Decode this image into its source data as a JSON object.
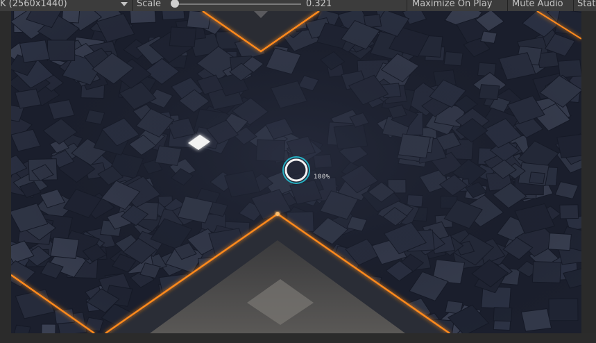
{
  "toolbar": {
    "resolution_label": "K (2560x1440)",
    "scale_label": "Scale",
    "scale_value": "0.321",
    "maximize_label": "Maximize On Play",
    "mute_label": "Mute Audio",
    "stats_label": "Stats"
  },
  "game_view": {
    "progress_text": "100%"
  },
  "colors": {
    "glow": "#ff8a1c",
    "floor": "#1b1f2d"
  }
}
